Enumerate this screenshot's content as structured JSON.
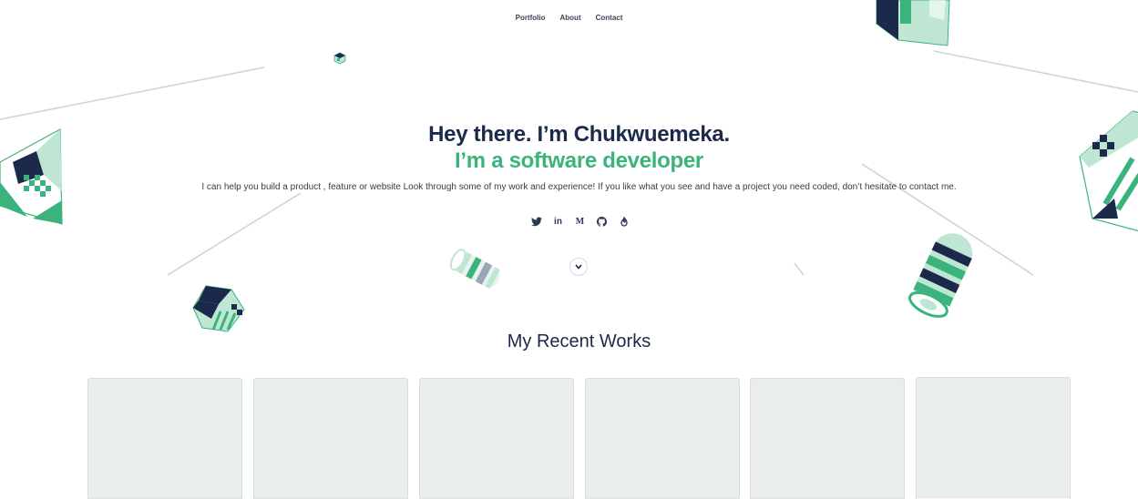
{
  "nav": {
    "items": [
      {
        "label": "Portfolio"
      },
      {
        "label": "About"
      },
      {
        "label": "Contact"
      }
    ]
  },
  "hero": {
    "title": "Hey there. I’m Chukwuemeka.",
    "subtitle": "I’m a software developer",
    "description": "I can help you build a product , feature or website Look through some of my work and experience! If you like what you see and have a project you need coded, don’t hesitate to contact me."
  },
  "socials": [
    {
      "icon": "twitter-icon"
    },
    {
      "icon": "linkedin-icon",
      "text": "in"
    },
    {
      "icon": "medium-icon",
      "text": "M"
    },
    {
      "icon": "github-icon"
    },
    {
      "icon": "hashnode-icon"
    }
  ],
  "scroll_icon": "chevron-down-icon",
  "works": {
    "title": "My Recent Works",
    "cards": [
      {
        "name": "work-card-1"
      },
      {
        "name": "work-card-2"
      },
      {
        "name": "work-card-3"
      },
      {
        "name": "work-card-4"
      },
      {
        "name": "work-card-5"
      },
      {
        "name": "work-card-6"
      }
    ]
  },
  "colors": {
    "navy": "#1b2a4a",
    "green": "#3bb37d",
    "light_green": "#bfe6d3",
    "card_bg": "#e9eeed"
  }
}
